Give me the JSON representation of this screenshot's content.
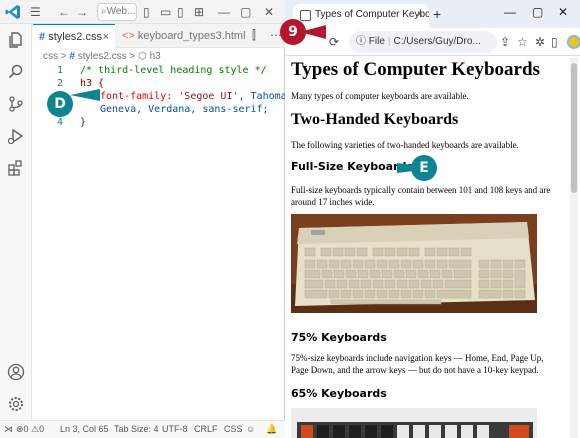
{
  "vscode": {
    "titlebar": {
      "search_text": "Web...",
      "menu_icon": "hamburger-menu-icon"
    },
    "tabs": [
      {
        "lang": "#",
        "label": "styles2.css",
        "close": "×"
      },
      {
        "lang": "<>",
        "label": "keyboard_types3.html"
      }
    ],
    "breadcrumb": {
      "folder": "css",
      "file": "styles2.css",
      "symbol": "h3"
    },
    "code_lines": [
      {
        "num": "1",
        "text": "/* third-level heading style */"
      },
      {
        "num": "2",
        "text": "h3 {"
      },
      {
        "num": "3",
        "prop": "font-family:",
        "str1": "'Segoe UI'",
        "rest": ", Tahoma,"
      },
      {
        "num": "",
        "text2": "Geneva, Verdana, sans-serif;"
      },
      {
        "num": "4",
        "text": "}"
      }
    ],
    "statusbar": {
      "problems": "⊗0 ⚠0",
      "position": "Ln 3, Col 65",
      "tabsize": "Tab Size: 4",
      "encoding": "UTF-8",
      "eol": "CRLF",
      "language": "CSS"
    }
  },
  "browser": {
    "tab_title": "Types of Computer Keyboards",
    "tab_close": "×",
    "new_tab": "+",
    "address": {
      "info_label": "File",
      "url": "C:/Users/Guy/Dro..."
    },
    "page": {
      "h1": "Types of Computer Keyboards",
      "intro": "Many types of computer keyboards are available.",
      "h2": "Two-Handed Keyboards",
      "two_handed_text": "The following varieties of two-handed keyboards are available.",
      "full_size_heading": "Full-Size Keyboards",
      "full_size_text": "Full-size keyboards typically contain between 101 and 108 keys and are around 17 inches wide.",
      "seventy_five_heading": "75% Keyboards",
      "seventy_five_text": "75%-size keyboards include navigation keys — Home, End, Page Up, Page Down, and the arrow keys — but do not have a 10-key keypad.",
      "sixty_five_heading": "65% Keyboards"
    }
  },
  "callouts": {
    "nine": "9",
    "d": "D",
    "e": "E",
    "nine_color": "#b4162e",
    "teal_color": "#0d8491"
  }
}
